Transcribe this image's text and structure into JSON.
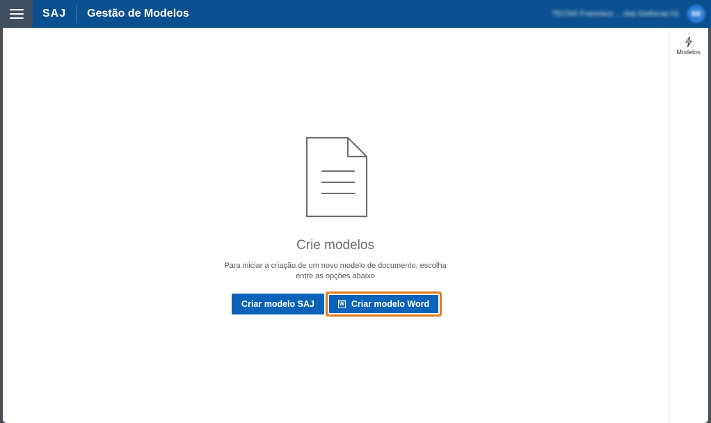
{
  "header": {
    "brand": "SAJ",
    "title": "Gestão de Modelos",
    "user_name": "TECNS Francisco ... das Gothicas 01",
    "user_initials": "BE"
  },
  "right_panel": {
    "items": [
      {
        "label": "Modelos",
        "icon": "lightning-icon"
      }
    ]
  },
  "empty_state": {
    "icon": "document-icon",
    "title": "Crie modelos",
    "description_line1": "Para iniciar a criação de um novo modelo de documento, escolha",
    "description_line2": "entre as opções abaixo"
  },
  "actions": {
    "create_saj": "Criar modelo SAJ",
    "create_word": "Criar modelo Word",
    "word_icon_glyph": "W"
  },
  "colors": {
    "topbar": "#0a4f8f",
    "primary_button": "#0a63b9",
    "highlight": "#e07a17"
  }
}
